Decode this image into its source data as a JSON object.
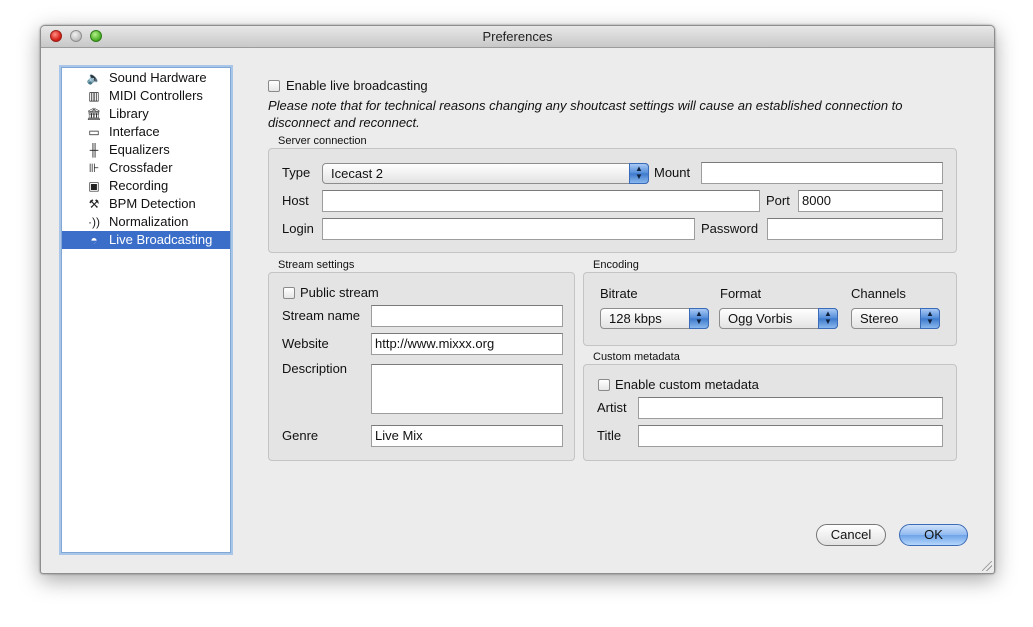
{
  "window": {
    "title": "Preferences"
  },
  "sidebar": {
    "items": [
      {
        "label": "Sound Hardware",
        "icon": "speaker-icon"
      },
      {
        "label": "MIDI Controllers",
        "icon": "keyboard-icon"
      },
      {
        "label": "Library",
        "icon": "library-icon"
      },
      {
        "label": "Interface",
        "icon": "monitor-icon"
      },
      {
        "label": "Equalizers",
        "icon": "equalizer-icon"
      },
      {
        "label": "Crossfader",
        "icon": "crossfader-icon"
      },
      {
        "label": "Recording",
        "icon": "recording-icon"
      },
      {
        "label": "BPM Detection",
        "icon": "bpm-icon"
      },
      {
        "label": "Normalization",
        "icon": "normalization-icon"
      },
      {
        "label": "Live Broadcasting",
        "icon": "broadcast-icon",
        "selected": true
      }
    ]
  },
  "broadcast": {
    "enable_label": "Enable live broadcasting",
    "note": "Please note that for technical reasons changing any shoutcast settings will cause an established connection to disconnect and reconnect."
  },
  "server": {
    "group_title": "Server connection",
    "type_label": "Type",
    "type_value": "Icecast 2",
    "mount_label": "Mount",
    "mount_value": "",
    "host_label": "Host",
    "host_value": "",
    "port_label": "Port",
    "port_value": "8000",
    "login_label": "Login",
    "login_value": "",
    "password_label": "Password",
    "password_value": ""
  },
  "stream": {
    "group_title": "Stream settings",
    "public_label": "Public stream",
    "name_label": "Stream name",
    "name_value": "",
    "website_label": "Website",
    "website_value": "http://www.mixxx.org",
    "description_label": "Description",
    "description_value": "",
    "genre_label": "Genre",
    "genre_value": "Live Mix"
  },
  "encoding": {
    "group_title": "Encoding",
    "bitrate_label": "Bitrate",
    "bitrate_value": "128 kbps",
    "format_label": "Format",
    "format_value": "Ogg Vorbis",
    "channels_label": "Channels",
    "channels_value": "Stereo"
  },
  "metadata": {
    "group_title": "Custom metadata",
    "enable_label": "Enable custom metadata",
    "artist_label": "Artist",
    "artist_value": "",
    "title_label": "Title",
    "title_value": ""
  },
  "buttons": {
    "cancel": "Cancel",
    "ok": "OK"
  },
  "colors": {
    "selection": "#3b6ec9",
    "ok_button": "#8fb9ef"
  }
}
